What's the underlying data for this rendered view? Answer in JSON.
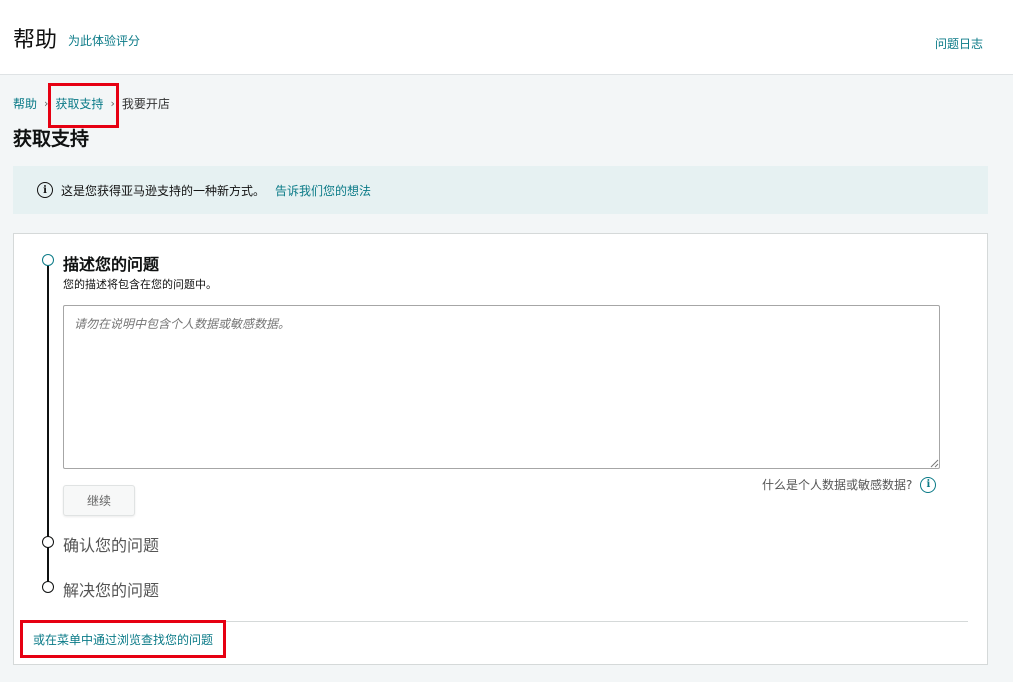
{
  "header": {
    "title": "帮助",
    "rate_link": "为此体验评分",
    "issue_log": "问题日志"
  },
  "breadcrumb": {
    "items": [
      "帮助",
      "获取支持",
      "我要开店"
    ],
    "separator": "›"
  },
  "page_title": "获取支持",
  "banner": {
    "icon": "info-icon",
    "text": "这是您获得亚马逊支持的一种新方式。",
    "link": "告诉我们您的想法"
  },
  "steps": [
    {
      "title": "描述您的问题",
      "subtitle": "您的描述将包含在您的问题中。",
      "active": true
    },
    {
      "title": "确认您的问题",
      "active": false
    },
    {
      "title": "解决您的问题",
      "active": false
    }
  ],
  "description_input": {
    "placeholder": "请勿在说明中包含个人数据或敏感数据。",
    "value": ""
  },
  "continue_button": "继续",
  "sensitive_data_link": "什么是个人数据或敏感数据?",
  "browse_link": "或在菜单中通过浏览查找您的问题",
  "colors": {
    "accent": "#0a7a87",
    "highlight": "#e60012",
    "banner_bg": "#e6f1f2",
    "page_bg": "#f3f6f7"
  }
}
